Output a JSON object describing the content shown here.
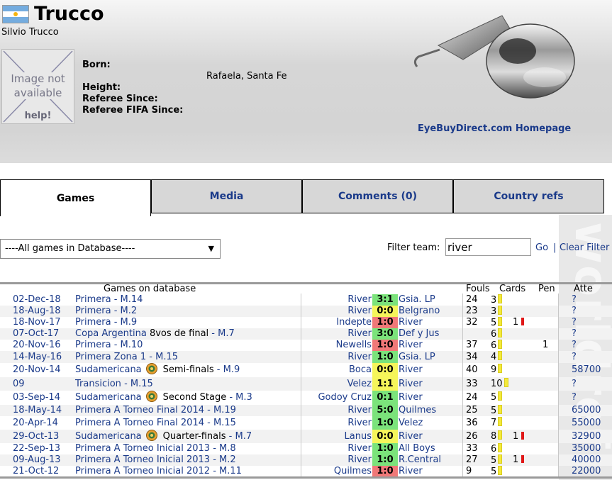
{
  "header": {
    "title": "Trucco",
    "full_name": "Silvio Trucco",
    "photo_text_1": "Image not",
    "photo_text_2": "available",
    "photo_help": "help!",
    "born_label": "Born:",
    "birthplace": "Rafaela, Santa Fe",
    "height_label": "Height:",
    "referee_since_label": "Referee Since:",
    "fifa_since_label": "Referee FIFA Since:",
    "ad_link": "EyeBuyDirect.com Homepage"
  },
  "tabs": [
    {
      "label": "Games",
      "active": true
    },
    {
      "label": "Media",
      "active": false
    },
    {
      "label": "Comments (0)",
      "active": false
    },
    {
      "label": "Country refs",
      "active": false
    }
  ],
  "filter": {
    "selected_option": "----All games in Database----",
    "label": "Filter team:",
    "value": "river",
    "go": "Go",
    "separator": "|",
    "clear": "Clear Filter"
  },
  "table": {
    "headers": {
      "games": "Games on database",
      "fouls": "Fouls",
      "cards": "Cards",
      "pen": "Pen",
      "att": "Atte"
    },
    "rows": [
      {
        "date": "02-Dec-18",
        "comp": "Primera",
        "comp_extra": "",
        "match": "M.14",
        "home": "River",
        "score": "3:1",
        "result": "win",
        "away": "Gsia. LP",
        "fouls": "24",
        "yellow": "3",
        "red": "",
        "pen": "",
        "att": "?"
      },
      {
        "date": "18-Aug-18",
        "comp": "Primera",
        "comp_extra": "",
        "match": "M.2",
        "home": "River",
        "score": "0:0",
        "result": "draw",
        "away": "Belgrano",
        "fouls": "23",
        "yellow": "3",
        "red": "",
        "pen": "",
        "att": "?"
      },
      {
        "date": "18-Nov-17",
        "comp": "Primera",
        "comp_extra": "",
        "match": "M.9",
        "home": "Indepte",
        "score": "1:0",
        "result": "loss",
        "away": "River",
        "fouls": "32",
        "yellow": "5",
        "red": "1",
        "pen": "",
        "att": "?"
      },
      {
        "date": "07-Oct-17",
        "comp": "Copa Argentina",
        "comp_extra": "8vos de final",
        "match": "M.7",
        "home": "River",
        "score": "3:0",
        "result": "win",
        "away": "Def y Jus",
        "fouls": "",
        "yellow": "6",
        "red": "",
        "pen": "",
        "att": "?"
      },
      {
        "date": "20-Nov-16",
        "comp": "Primera",
        "comp_extra": "",
        "match": "M.10",
        "home": "Newells",
        "score": "1:0",
        "result": "loss",
        "away": "River",
        "fouls": "37",
        "yellow": "6",
        "red": "",
        "pen": "1",
        "att": "?"
      },
      {
        "date": "14-May-16",
        "comp": "Primera Zona 1",
        "comp_extra": "",
        "match": "M.15",
        "home": "River",
        "score": "1:0",
        "result": "win",
        "away": "Gsia. LP",
        "fouls": "34",
        "yellow": "4",
        "red": "",
        "pen": "",
        "att": "?"
      },
      {
        "date": "20-Nov-14",
        "comp": "Sudamericana",
        "comp_extra": "Semi-finals",
        "match": "M.9",
        "home": "Boca",
        "score": "0:0",
        "result": "draw",
        "away": "River",
        "fouls": "40",
        "yellow": "9",
        "red": "",
        "pen": "",
        "att": "58700",
        "cup": true
      },
      {
        "date": "09",
        "comp": "Transicion",
        "comp_extra": "",
        "match": "M.15",
        "home": "Velez",
        "score": "1:1",
        "result": "draw",
        "away": "River",
        "fouls": "33",
        "yellow": "10",
        "red": "",
        "pen": "",
        "att": "?"
      },
      {
        "date": "03-Sep-14",
        "comp": "Sudamericana",
        "comp_extra": "Second Stage",
        "match": "M.3",
        "home": "Godoy Cruz",
        "score": "0:1",
        "result": "win",
        "away": "River",
        "fouls": "24",
        "yellow": "5",
        "red": "",
        "pen": "",
        "att": "?",
        "cup": true
      },
      {
        "date": "18-May-14",
        "comp": "Primera A Torneo Final 2014",
        "comp_extra": "",
        "match": "M.19",
        "home": "River",
        "score": "5:0",
        "result": "win",
        "away": "Quilmes",
        "fouls": "25",
        "yellow": "5",
        "red": "",
        "pen": "",
        "att": "65000"
      },
      {
        "date": "20-Apr-14",
        "comp": "Primera A Torneo Final 2014",
        "comp_extra": "",
        "match": "M.15",
        "home": "River",
        "score": "1:0",
        "result": "win",
        "away": "Velez",
        "fouls": "36",
        "yellow": "7",
        "red": "",
        "pen": "",
        "att": "55000"
      },
      {
        "date": "29-Oct-13",
        "comp": "Sudamericana",
        "comp_extra": "Quarter-finals",
        "match": "M.7",
        "home": "Lanus",
        "score": "0:0",
        "result": "draw",
        "away": "River",
        "fouls": "26",
        "yellow": "8",
        "red": "1",
        "pen": "",
        "att": "32900",
        "cup": true
      },
      {
        "date": "22-Sep-13",
        "comp": "Primera A Torneo Inicial 2013",
        "comp_extra": "",
        "match": "M.8",
        "home": "River",
        "score": "1:0",
        "result": "win",
        "away": "All Boys",
        "fouls": "33",
        "yellow": "6",
        "red": "",
        "pen": "",
        "att": "35000"
      },
      {
        "date": "09-Aug-13",
        "comp": "Primera A Torneo Inicial 2013",
        "comp_extra": "",
        "match": "M.2",
        "home": "River",
        "score": "1:0",
        "result": "win",
        "away": "R.Central",
        "fouls": "27",
        "yellow": "5",
        "red": "1",
        "pen": "",
        "att": "40000"
      },
      {
        "date": "21-Oct-12",
        "comp": "Primera A Torneo Inicial 2012",
        "comp_extra": "",
        "match": "M.11",
        "home": "Quilmes",
        "score": "1:0",
        "result": "loss",
        "away": "River",
        "fouls": "9",
        "yellow": "5",
        "red": "",
        "pen": "",
        "att": "22000"
      }
    ]
  },
  "colors": {
    "link": "#1a3a8a",
    "win": "#7be37b",
    "draw": "#f5f55a",
    "loss": "#f07878"
  },
  "icons": {
    "flag": "argentina-flag-icon",
    "whistle": "whistle-icon",
    "cup": "copa-sudamericana-icon",
    "yellow_card": "yellow-card-icon",
    "red_card": "red-card-icon"
  }
}
